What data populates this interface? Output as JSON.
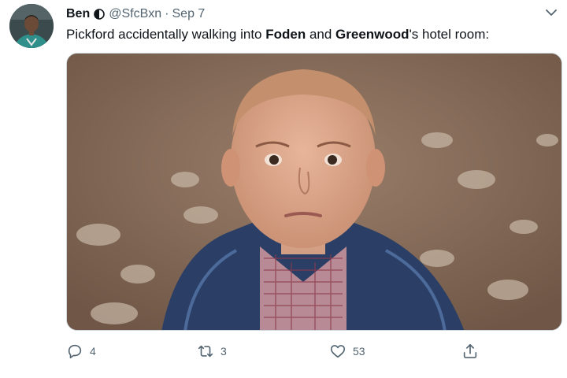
{
  "tweet": {
    "author_name": "Ben",
    "handle": "@SfcBxn",
    "separator": "·",
    "date": "Sep 7",
    "text_parts": [
      "Pickford accidentally walking into ",
      "Foden",
      " and ",
      "Greenwood",
      "'s hotel room:"
    ]
  },
  "actions": {
    "reply_count": "4",
    "retweet_count": "3",
    "like_count": "53"
  },
  "icons": {
    "badge": "half-circle-badge-icon",
    "caret": "chevron-down-icon",
    "reply": "reply-icon",
    "retweet": "retweet-icon",
    "like": "heart-icon",
    "share": "share-icon"
  }
}
